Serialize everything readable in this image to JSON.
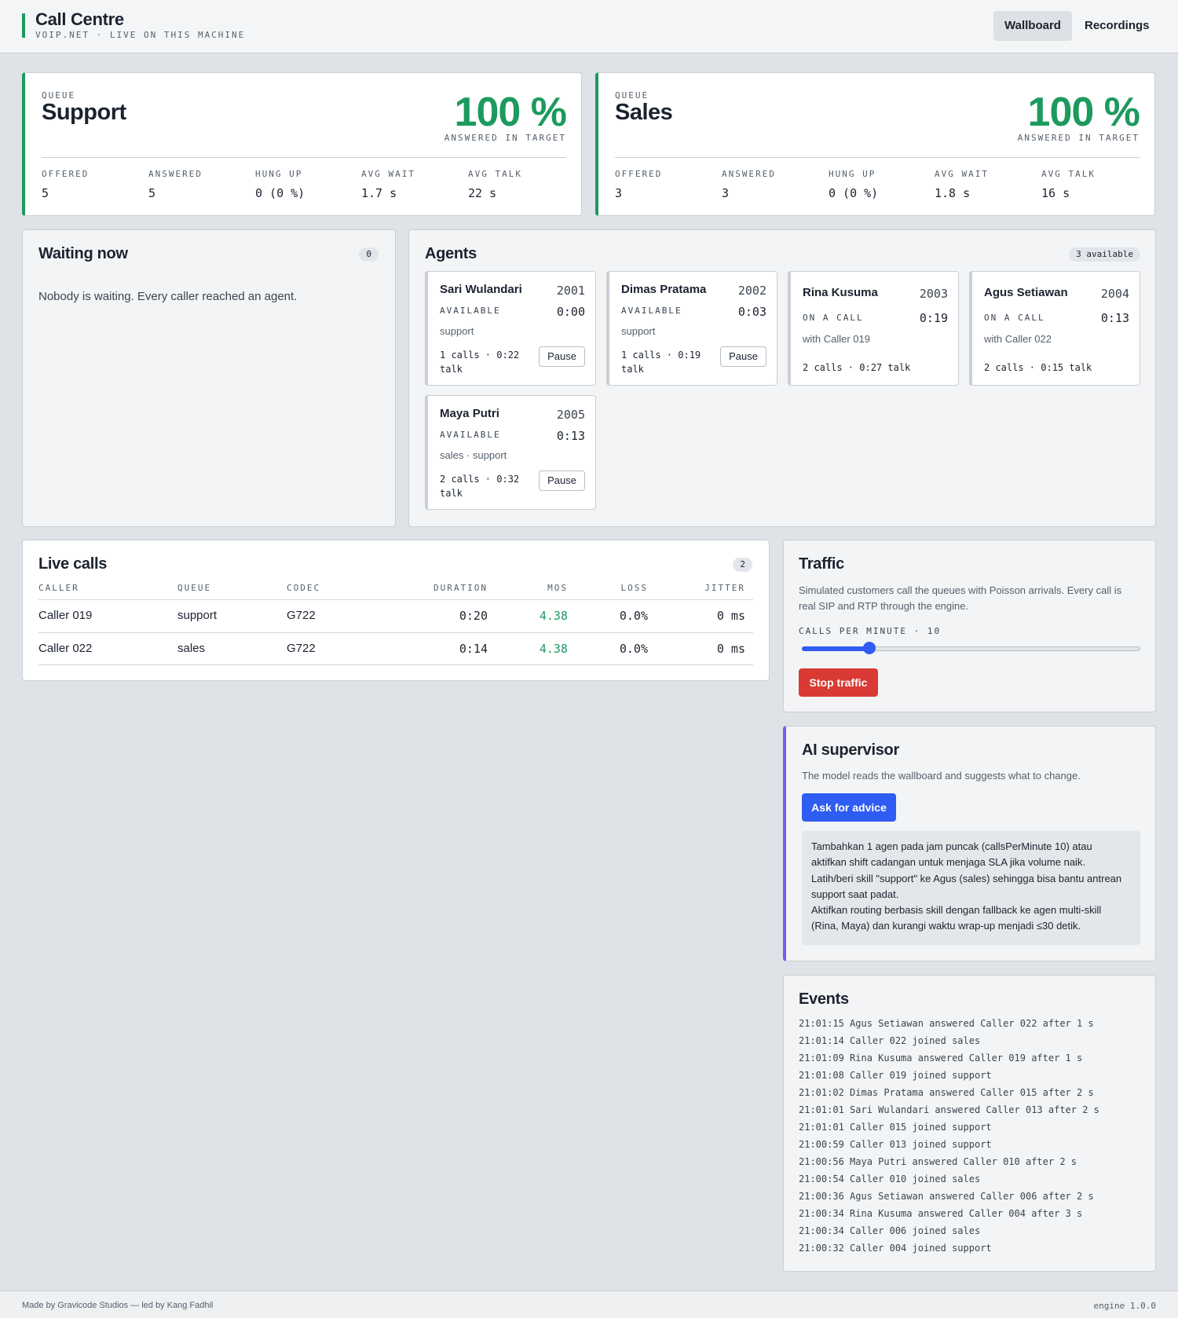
{
  "header": {
    "title": "Call Centre",
    "subtitle": "VOIP.NET · LIVE ON THIS MACHINE",
    "nav": {
      "wallboard": "Wallboard",
      "recordings": "Recordings"
    }
  },
  "queues": [
    {
      "label": "QUEUE",
      "name": "Support",
      "percent": "100 %",
      "percent_label": "ANSWERED IN TARGET",
      "stats": [
        {
          "label": "OFFERED",
          "value": "5"
        },
        {
          "label": "ANSWERED",
          "value": "5"
        },
        {
          "label": "HUNG UP",
          "value": "0 (0 %)"
        },
        {
          "label": "AVG WAIT",
          "value": "1.7 s"
        },
        {
          "label": "AVG TALK",
          "value": "22 s"
        }
      ]
    },
    {
      "label": "QUEUE",
      "name": "Sales",
      "percent": "100 %",
      "percent_label": "ANSWERED IN TARGET",
      "stats": [
        {
          "label": "OFFERED",
          "value": "3"
        },
        {
          "label": "ANSWERED",
          "value": "3"
        },
        {
          "label": "HUNG UP",
          "value": "0 (0 %)"
        },
        {
          "label": "AVG WAIT",
          "value": "1.8 s"
        },
        {
          "label": "AVG TALK",
          "value": "16 s"
        }
      ]
    }
  ],
  "waiting": {
    "title": "Waiting now",
    "count": "0",
    "message": "Nobody is waiting. Every caller reached an agent."
  },
  "agents": {
    "title": "Agents",
    "available_badge": "3 available",
    "pause_label": "Pause",
    "list": [
      {
        "name": "Sari Wulandari",
        "ext": "2001",
        "status": "AVAILABLE",
        "timer": "0:00",
        "sub": "support",
        "stats_line1": "1 calls · 0:22",
        "stats_line2": "talk"
      },
      {
        "name": "Dimas Pratama",
        "ext": "2002",
        "status": "AVAILABLE",
        "timer": "0:03",
        "sub": "support",
        "stats_line1": "1 calls · 0:19",
        "stats_line2": "talk"
      },
      {
        "name": "Rina Kusuma",
        "ext": "2003",
        "status": "ON A CALL",
        "timer": "0:19",
        "sub": "with Caller 019",
        "stats": "2 calls · 0:27 talk"
      },
      {
        "name": "Agus Setiawan",
        "ext": "2004",
        "status": "ON A CALL",
        "timer": "0:13",
        "sub": "with Caller 022",
        "stats": "2 calls · 0:15 talk"
      },
      {
        "name": "Maya Putri",
        "ext": "2005",
        "status": "AVAILABLE",
        "timer": "0:13",
        "sub": "sales · support",
        "stats_line1": "2 calls · 0:32",
        "stats_line2": "talk"
      }
    ]
  },
  "live_calls": {
    "title": "Live calls",
    "count": "2",
    "columns": [
      "CALLER",
      "QUEUE",
      "CODEC",
      "DURATION",
      "MOS",
      "LOSS",
      "JITTER"
    ],
    "rows": [
      [
        "Caller 019",
        "support",
        "G722",
        "0:20",
        "4.38",
        "0.0%",
        "0 ms"
      ],
      [
        "Caller 022",
        "sales",
        "G722",
        "0:14",
        "4.38",
        "0.0%",
        "0 ms"
      ]
    ]
  },
  "traffic": {
    "title": "Traffic",
    "description_line1": "Simulated customers call the queues with Poisson arrivals. Every call is",
    "description_line2": "real SIP and RTP through the engine.",
    "rate_label": "CALLS PER MINUTE · 10",
    "slider_fraction": 0.2,
    "stop_button": "Stop traffic"
  },
  "ai": {
    "title": "AI supervisor",
    "description": "The model reads the wallboard and suggests what to change.",
    "ask_button": "Ask for advice",
    "advice_lines": [
      "Tambahkan 1 agen pada jam puncak (callsPerMinute 10) atau",
      "aktifkan shift cadangan untuk menjaga SLA jika volume naik.",
      "Latih/beri skill \"support\" ke Agus (sales) sehingga bisa bantu antrean",
      "support saat padat.",
      "Aktifkan routing berbasis skill dengan fallback ke agen multi-skill",
      "(Rina, Maya) dan kurangi waktu wrap-up menjadi ≤30 detik."
    ]
  },
  "events": {
    "title": "Events",
    "items": [
      "21:01:15 Agus Setiawan answered Caller 022 after 1 s",
      "21:01:14 Caller 022 joined sales",
      "21:01:09 Rina Kusuma answered Caller 019 after 1 s",
      "21:01:08 Caller 019 joined support",
      "21:01:02 Dimas Pratama answered Caller 015 after 2 s",
      "21:01:01 Sari Wulandari answered Caller 013 after 2 s",
      "21:01:01 Caller 015 joined support",
      "21:00:59 Caller 013 joined support",
      "21:00:56 Maya Putri answered Caller 010 after 2 s",
      "21:00:54 Caller 010 joined sales",
      "21:00:36 Agus Setiawan answered Caller 006 after 2 s",
      "21:00:34 Rina Kusuma answered Caller 004 after 3 s",
      "21:00:34 Caller 006 joined sales",
      "21:00:32 Caller 004 joined support"
    ]
  },
  "footer": {
    "credit": "Made by Gravicode Studios — led by Kang Fadhil",
    "version": "engine 1.0.0"
  },
  "colors": {
    "accent_green": "#1d9a5e",
    "accent_blue": "#2f5cf2",
    "accent_red": "#d93a33",
    "accent_purple": "#7a5af0"
  }
}
